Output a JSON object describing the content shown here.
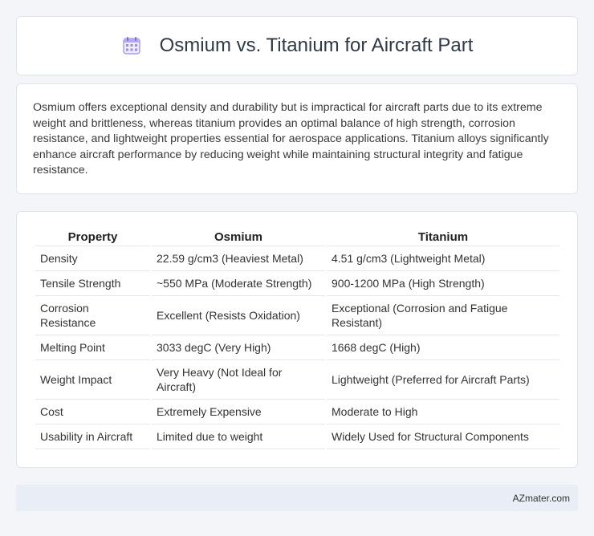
{
  "header": {
    "title": "Osmium vs. Titanium for Aircraft Part",
    "icon": "calendar-icon"
  },
  "summary": {
    "text": "Osmium offers exceptional density and durability but is impractical for aircraft parts due to its extreme weight and brittleness, whereas titanium provides an optimal balance of high strength, corrosion resistance, and lightweight properties essential for aerospace applications. Titanium alloys significantly enhance aircraft performance by reducing weight while maintaining structural integrity and fatigue resistance."
  },
  "table": {
    "headers": [
      "Property",
      "Osmium",
      "Titanium"
    ],
    "rows": [
      [
        "Density",
        "22.59 g/cm3 (Heaviest Metal)",
        "4.51 g/cm3 (Lightweight Metal)"
      ],
      [
        "Tensile Strength",
        "~550 MPa (Moderate Strength)",
        "900-1200 MPa (High Strength)"
      ],
      [
        "Corrosion Resistance",
        "Excellent (Resists Oxidation)",
        "Exceptional (Corrosion and Fatigue Resistant)"
      ],
      [
        "Melting Point",
        "3033 degC (Very High)",
        "1668 degC (High)"
      ],
      [
        "Weight Impact",
        "Very Heavy (Not Ideal for Aircraft)",
        "Lightweight (Preferred for Aircraft Parts)"
      ],
      [
        "Cost",
        "Extremely Expensive",
        "Moderate to High"
      ],
      [
        "Usability in Aircraft",
        "Limited due to weight",
        "Widely Used for Structural Components"
      ]
    ]
  },
  "footer": {
    "site": "AZmater.com"
  },
  "colors": {
    "background": "#f3f5f9",
    "card": "#ffffff",
    "footer": "#e8edf6",
    "icon_accent": "#8b7ad8"
  }
}
